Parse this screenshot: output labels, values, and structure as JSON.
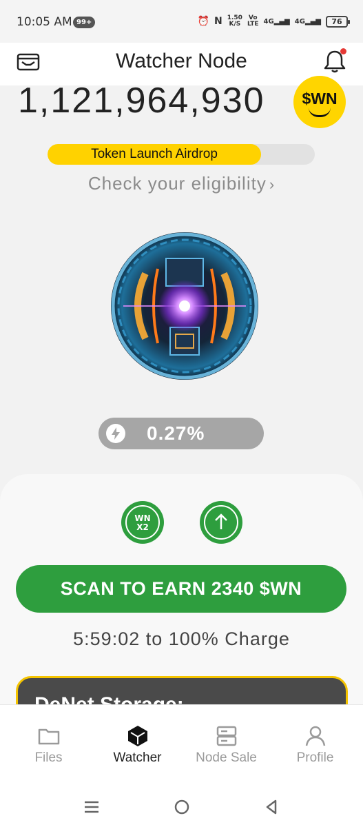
{
  "status_bar": {
    "time": "10:05 AM",
    "notification_count": "99+",
    "speed_value": "1.50",
    "speed_unit": "K/S",
    "volte_top": "Vo",
    "volte_bottom": "LTE",
    "net1": "4G",
    "net2": "4G",
    "battery": "76"
  },
  "header": {
    "title": "Watcher Node",
    "has_notification": true
  },
  "balance": {
    "amount": "1,121,964,930",
    "token_label": "$WN"
  },
  "airdrop": {
    "label": "Token Launch Airdrop",
    "progress_fraction": 0.8,
    "eligibility_link": "Check your eligibility",
    "eligibility_chevron": "›"
  },
  "charge": {
    "value": "0.27%",
    "icon": "bolt-icon"
  },
  "boosts": {
    "multiplier_line1": "WN",
    "multiplier_line2": "X2",
    "upgrade_icon": "arrow-up-icon"
  },
  "scan": {
    "button_label": "SCAN TO EARN 2340 $WN",
    "timer": "5:59:02 to 100% Charge"
  },
  "promo": {
    "title": "DeNet Storage:"
  },
  "bottom_nav": {
    "items": [
      {
        "label": "Files",
        "icon": "folder-icon"
      },
      {
        "label": "Watcher",
        "icon": "cube-icon"
      },
      {
        "label": "Node Sale",
        "icon": "server-icon"
      },
      {
        "label": "Profile",
        "icon": "person-icon"
      }
    ],
    "active_index": 1
  },
  "colors": {
    "accent_green": "#2e9e3e",
    "accent_yellow": "#ffd200",
    "pill_gray": "#a6a6a6"
  }
}
